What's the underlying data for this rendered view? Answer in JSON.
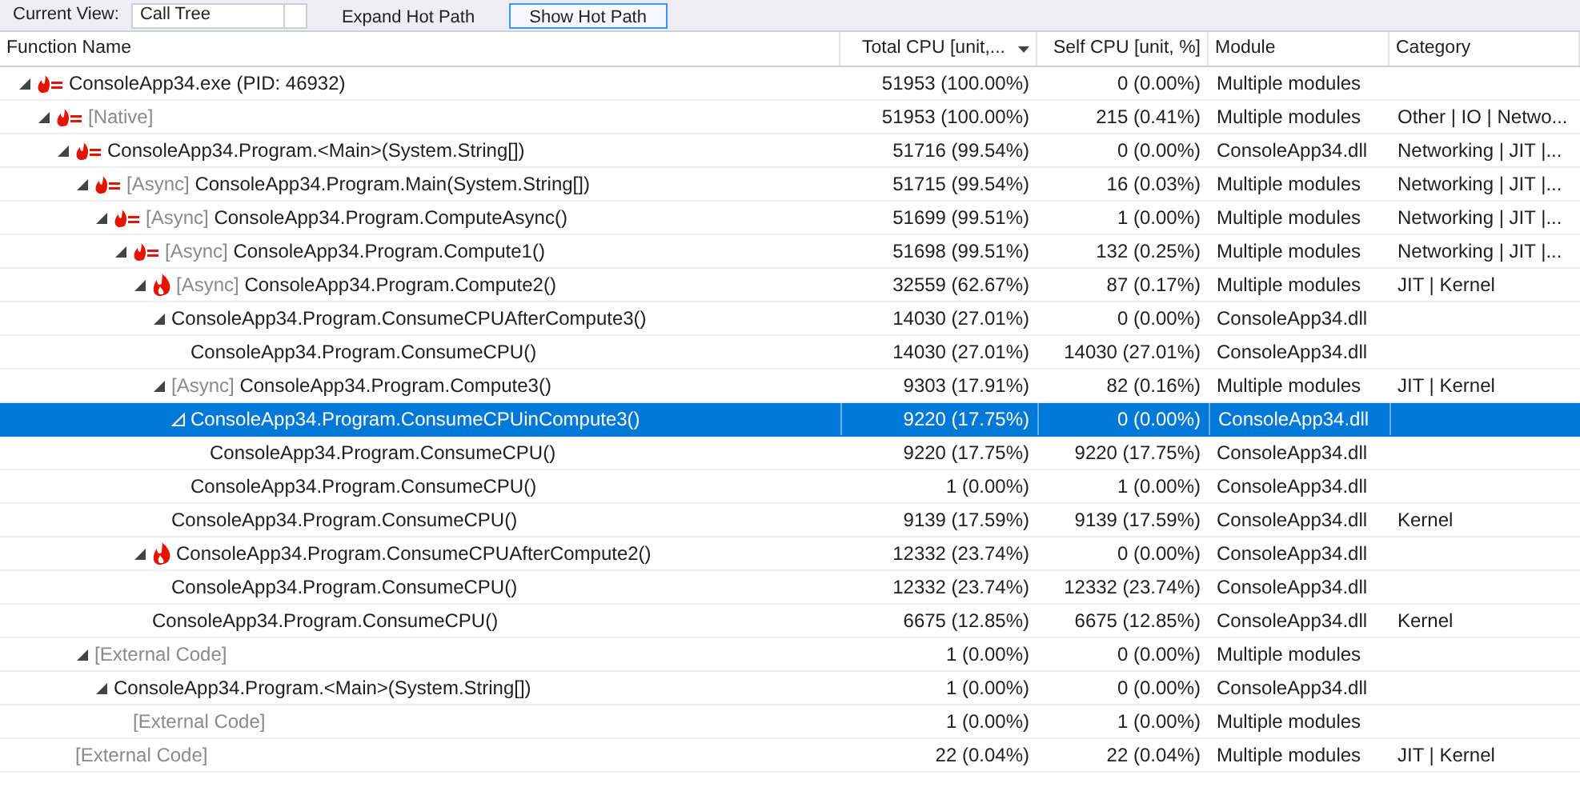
{
  "toolbar": {
    "view_label": "Current View:",
    "view_value": "Call Tree",
    "buttons": [
      {
        "label": "Expand Hot Path",
        "selected": false
      },
      {
        "label": "Show Hot Path",
        "selected": true
      }
    ]
  },
  "columns": [
    {
      "label": "Function Name",
      "sorted": false
    },
    {
      "label": "Total CPU [unit,...",
      "sorted": true
    },
    {
      "label": "Self CPU [unit, %]",
      "sorted": false
    },
    {
      "label": "Module",
      "sorted": false
    },
    {
      "label": "Category",
      "sorted": false
    }
  ],
  "rows": [
    {
      "name": "ConsoleApp34.exe (PID: 46932)",
      "kind": "hot",
      "muted": false,
      "selected": false,
      "expanded": true,
      "total": "51953 (100.00%)",
      "self": "0 (0.00%)",
      "module": "Multiple modules",
      "children": [
        {
          "name": "[Native]",
          "kind": "hot",
          "muted": true,
          "selected": false,
          "expanded": true,
          "total": "51953 (100.00%)",
          "self": "215 (0.41%)",
          "module": "Multiple modules",
          "category": "Other | IO | Netwo...",
          "children": [
            {
              "name": "ConsoleApp34.Program.<Main>(System.String[])",
              "kind": "hot",
              "muted": false,
              "selected": false,
              "expanded": true,
              "total": "51716 (99.54%)",
              "self": "0 (0.00%)",
              "module": "ConsoleApp34.dll",
              "category": "Networking | JIT |...",
              "children": [
                {
                  "prefix": "[Async]",
                  "name": "ConsoleApp34.Program.Main(System.String[])",
                  "kind": "hot",
                  "muted": false,
                  "selected": false,
                  "expanded": true,
                  "total": "51715 (99.54%)",
                  "self": "16 (0.03%)",
                  "module": "Multiple modules",
                  "category": "Networking | JIT |...",
                  "children": [
                    {
                      "prefix": "[Async]",
                      "name": "ConsoleApp34.Program.ComputeAsync()",
                      "kind": "hot",
                      "muted": false,
                      "selected": false,
                      "expanded": true,
                      "total": "51699 (99.51%)",
                      "self": "1 (0.00%)",
                      "module": "Multiple modules",
                      "category": "Networking | JIT |...",
                      "children": [
                        {
                          "prefix": "[Async]",
                          "name": "ConsoleApp34.Program.Compute1()",
                          "kind": "hot",
                          "muted": false,
                          "selected": false,
                          "expanded": true,
                          "total": "51698 (99.51%)",
                          "self": "132 (0.25%)",
                          "module": "Multiple modules",
                          "category": "Networking | JIT |...",
                          "children": [
                            {
                              "prefix": "[Async]",
                              "name": "ConsoleApp34.Program.Compute2()",
                              "kind": "flame",
                              "muted": false,
                              "selected": false,
                              "expanded": true,
                              "total": "32559 (62.67%)",
                              "self": "87 (0.17%)",
                              "module": "Multiple modules",
                              "category": "JIT | Kernel",
                              "children": [
                                {
                                  "name": "ConsoleApp34.Program.ConsumeCPUAfterCompute3()",
                                  "muted": false,
                                  "selected": false,
                                  "expanded": true,
                                  "total": "14030 (27.01%)",
                                  "self": "0 (0.00%)",
                                  "module": "ConsoleApp34.dll",
                                  "children": [
                                    {
                                      "name": "ConsoleApp34.Program.ConsumeCPU()",
                                      "muted": false,
                                      "selected": false,
                                      "total": "14030 (27.01%)",
                                      "self": "14030 (27.01%)",
                                      "module": "ConsoleApp34.dll"
                                    }
                                  ]
                                },
                                {
                                  "prefix": "[Async]",
                                  "name": "ConsoleApp34.Program.Compute3()",
                                  "muted": false,
                                  "selected": false,
                                  "expanded": true,
                                  "total": "9303 (17.91%)",
                                  "self": "82 (0.16%)",
                                  "module": "Multiple modules",
                                  "category": "JIT | Kernel",
                                  "children": [
                                    {
                                      "name": "ConsoleApp34.Program.ConsumeCPUinCompute3()",
                                      "muted": false,
                                      "selected": true,
                                      "expanded": true,
                                      "total": "9220 (17.75%)",
                                      "self": "0 (0.00%)",
                                      "module": "ConsoleApp34.dll",
                                      "children": [
                                        {
                                          "name": "ConsoleApp34.Program.ConsumeCPU()",
                                          "muted": false,
                                          "selected": false,
                                          "total": "9220 (17.75%)",
                                          "self": "9220 (17.75%)",
                                          "module": "ConsoleApp34.dll"
                                        }
                                      ]
                                    },
                                    {
                                      "name": "ConsoleApp34.Program.ConsumeCPU()",
                                      "muted": false,
                                      "selected": false,
                                      "total": "1 (0.00%)",
                                      "self": "1 (0.00%)",
                                      "module": "ConsoleApp34.dll"
                                    }
                                  ]
                                },
                                {
                                  "name": "ConsoleApp34.Program.ConsumeCPU()",
                                  "muted": false,
                                  "selected": false,
                                  "total": "9139 (17.59%)",
                                  "self": "9139 (17.59%)",
                                  "module": "ConsoleApp34.dll",
                                  "category": "Kernel"
                                }
                              ]
                            },
                            {
                              "name": "ConsoleApp34.Program.ConsumeCPUAfterCompute2()",
                              "kind": "flame",
                              "muted": false,
                              "selected": false,
                              "expanded": true,
                              "total": "12332 (23.74%)",
                              "self": "0 (0.00%)",
                              "module": "ConsoleApp34.dll",
                              "children": [
                                {
                                  "name": "ConsoleApp34.Program.ConsumeCPU()",
                                  "muted": false,
                                  "selected": false,
                                  "total": "12332 (23.74%)",
                                  "self": "12332 (23.74%)",
                                  "module": "ConsoleApp34.dll"
                                }
                              ]
                            },
                            {
                              "name": "ConsoleApp34.Program.ConsumeCPU()",
                              "muted": false,
                              "selected": false,
                              "total": "6675 (12.85%)",
                              "self": "6675 (12.85%)",
                              "module": "ConsoleApp34.dll",
                              "category": "Kernel"
                            }
                          ]
                        }
                      ]
                    }
                  ]
                },
                {
                  "name": "[External Code]",
                  "muted": true,
                  "selected": false,
                  "expanded": true,
                  "total": "1 (0.00%)",
                  "self": "0 (0.00%)",
                  "module": "Multiple modules",
                  "children": [
                    {
                      "name": "ConsoleApp34.Program.<Main>(System.String[])",
                      "muted": false,
                      "selected": false,
                      "expanded": true,
                      "total": "1 (0.00%)",
                      "self": "0 (0.00%)",
                      "module": "ConsoleApp34.dll",
                      "children": [
                        {
                          "name": "[External Code]",
                          "muted": true,
                          "selected": false,
                          "total": "1 (0.00%)",
                          "self": "1 (0.00%)",
                          "module": "Multiple modules"
                        }
                      ]
                    }
                  ]
                }
              ]
            },
            {
              "name": "[External Code]",
              "muted": true,
              "selected": false,
              "total": "22 (0.04%)",
              "self": "22 (0.04%)",
              "module": "Multiple modules",
              "category": "JIT | Kernel"
            }
          ]
        }
      ]
    }
  ]
}
